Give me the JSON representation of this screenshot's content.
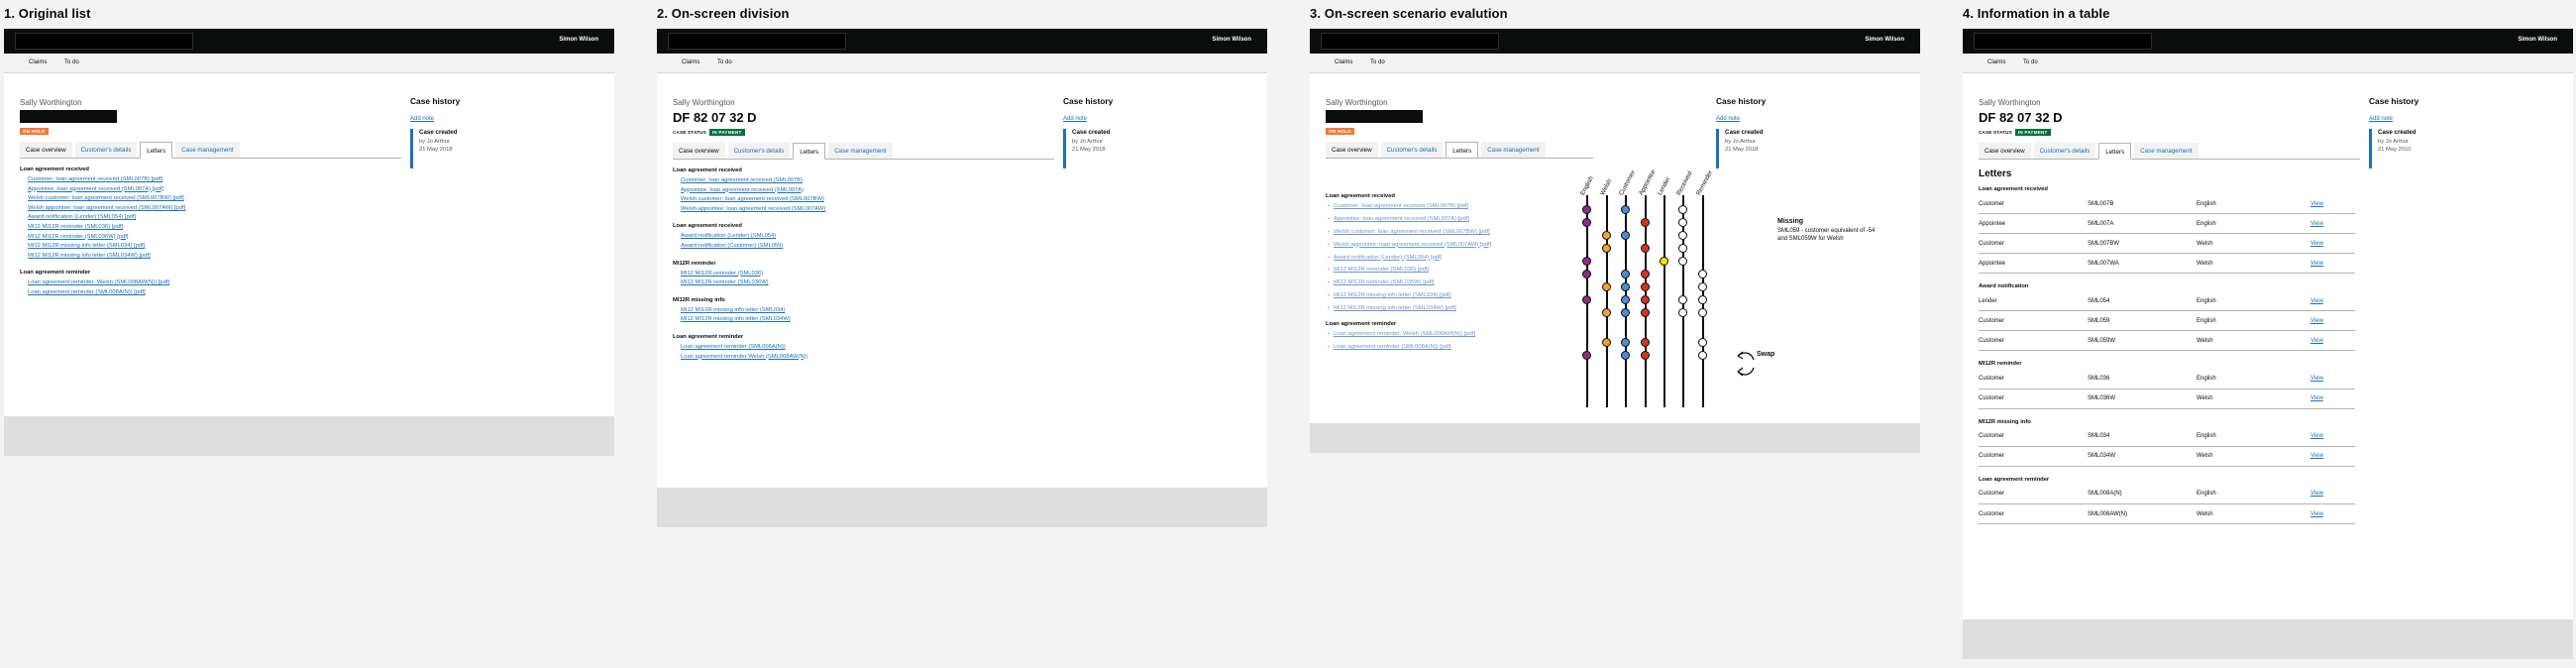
{
  "panels": [
    {
      "title": "1. Original list"
    },
    {
      "title": "2. On-screen division"
    },
    {
      "title": "3. On-screen scenario evalution"
    },
    {
      "title": "4. Information in a table"
    }
  ],
  "header": {
    "user": "Simon Wilson"
  },
  "nav": {
    "claims": "Claims",
    "todo": "To do"
  },
  "client": {
    "name": "Sally Worthington",
    "nino": "DF 82 07 32 D",
    "status_label": "CASE STATUS",
    "status_payment": "IN PAYMENT",
    "status_onhold": "ON HOLD"
  },
  "tabs": [
    "Case overview",
    "Customer's details",
    "Letters",
    "Case management"
  ],
  "case_history": {
    "title": "Case history",
    "add_note": "Add note",
    "event": "Case created",
    "by": "by Jo Arthur",
    "date1": "21 May 2018",
    "date4": "21 May 2010"
  },
  "p1": {
    "section1": "Loan agreement received",
    "links1": [
      "Customer: loan agreement received (SML007B) [pdf]",
      "Appointee: loan agreement received (SML007A) [pdf]",
      "Welsh customer: loan agreement received (SML007BW) [pdf]",
      "Welsh appointee: loan agreement received (SML007AW) [pdf]",
      "Award notification (Lender) (SML054) [pdf]",
      "MI12 MI12R reminder (SML036) [pdf]",
      "MI12 MI12R reminder (SML036W) [pdf]",
      "MI12 MI12R missing info letter (SML034) [pdf]",
      "MI12 MI12R missing info letter (SML034W) [pdf]"
    ],
    "section2": "Loan agreement reminder",
    "links2": [
      "Loan agreement reminder: Welsh (SML008AW(N)) [pdf]",
      "Loan agreement reminder (SML008A(N)) [pdf]"
    ]
  },
  "p2": {
    "groups": [
      {
        "title": "Loan agreement received",
        "links": [
          "Customer: loan agreement received (SML007B)",
          "Appointee: loan agreement received (SML007A)",
          "Welsh customer: loan agreement received (SML007BW)",
          "Welsh appointee: loan agreement received (SML007AW)"
        ]
      },
      {
        "title": "Loan agreement received",
        "links": [
          "Award notification (Lender) (SML054)",
          "Award notification (Customer) (SML059)"
        ]
      },
      {
        "title": "MI12R reminder",
        "links": [
          "MI12 MI12R reminder (SML036)",
          "MI12 MI12R reminder (SML036W)"
        ]
      },
      {
        "title": "MI12R missing info",
        "links": [
          "MI12 MI12R missing info letter (SML034)",
          "MI12 MI12R missing info letter (SML034W)"
        ]
      },
      {
        "title": "Loan agreement reminder",
        "links": [
          "Loan agreement reminder (SML008A(N))",
          "Loan agreement reminder Welsh (SML008AW(N))"
        ]
      }
    ]
  },
  "p3": {
    "columns": [
      "English",
      "Welsh",
      "Customer",
      "Appointee",
      "Lender",
      "Received",
      "Reminder"
    ],
    "section1": "Loan agreement received",
    "rows1": [
      "Customer: loan agreement received (SML007B) [pdf]",
      "Appointee: loan agreement received (SML007A) [pdf]",
      "Welsh customer: loan agreement received (SML007BW) [pdf]",
      "Welsh appointee: loan agreement received (SML007AW) [pdf]",
      "Award notification (Lender) (SML054) [pdf]",
      "MI12 MI12R reminder (SML036) [pdf]",
      "MI12 MI12R reminder (SML036W) [pdf]",
      "MI12 MI12R missing info letter (SML034) [pdf]",
      "MI12 MI12R missing info letter (SML034W) [pdf]"
    ],
    "section2": "Loan agreement reminder",
    "rows2": [
      "Loan agreement reminder: Welsh (SML008AW(N)) [pdf]",
      "Loan agreement reminder (SML008A(N)) [pdf]"
    ],
    "missing_title": "Missing",
    "missing_text1": "SML059 - customer equivalent of -54",
    "missing_text2": "and SML059W for Welsh",
    "swap_label": "Swap",
    "colors": {
      "english": "#912b88",
      "welsh": "#f5a031",
      "customer": "#4f8ad6",
      "appointee": "#d4351c",
      "lender": "#ffdd00"
    }
  },
  "p4": {
    "heading": "Letters",
    "groups": [
      {
        "title": "Loan agreement received",
        "rows": [
          [
            "Customer",
            "SML007B",
            "English",
            "View"
          ],
          [
            "Appointee",
            "SML007A",
            "English",
            "View"
          ],
          [
            "Customer",
            "SML007BW",
            "Welsh",
            "View"
          ],
          [
            "Appointee",
            "SML007WA",
            "Welsh",
            "View"
          ]
        ]
      },
      {
        "title": "Award notification",
        "rows": [
          [
            "Lender",
            "SML054",
            "English",
            "View"
          ],
          [
            "Customer",
            "SML059",
            "English",
            "View"
          ],
          [
            "Customer",
            "SML059W",
            "Welsh",
            "View"
          ]
        ]
      },
      {
        "title": "MI12R reminder",
        "rows": [
          [
            "Customer",
            "SML036",
            "English",
            "View"
          ],
          [
            "Customer",
            "SML036W",
            "Welsh",
            "View"
          ]
        ]
      },
      {
        "title": "MI12R missing info",
        "rows": [
          [
            "Customer",
            "SML034",
            "English",
            "View"
          ],
          [
            "Customer",
            "SML034W",
            "Welsh",
            "View"
          ]
        ]
      },
      {
        "title": "Loan agreement reminder",
        "rows": [
          [
            "Customer",
            "SML008A(N)",
            "English",
            "View"
          ],
          [
            "Customer",
            "SML008AW(N)",
            "Welsh",
            "View"
          ]
        ]
      }
    ]
  }
}
